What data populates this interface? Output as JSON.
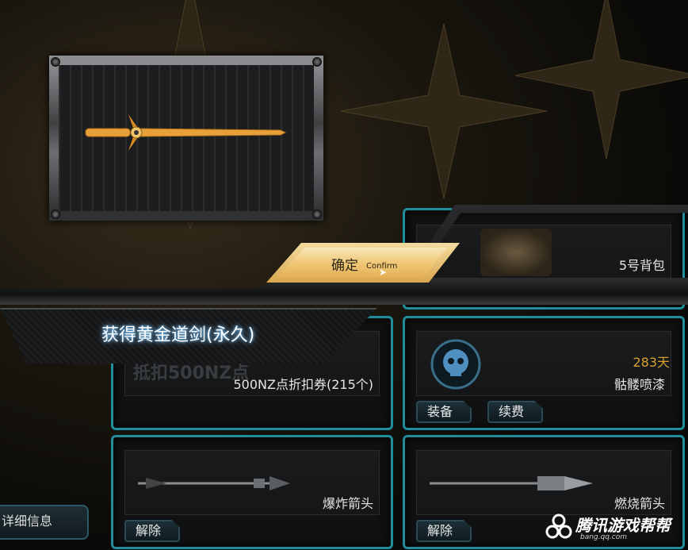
{
  "banner": {
    "title": "获得黄金道剑(永久)"
  },
  "confirm": {
    "label": "确定",
    "sub_label": "Confirm"
  },
  "cards": [
    {
      "id": "backpack",
      "name": "5号背包"
    },
    {
      "id": "coupon",
      "name": "500NZ点折扣券(215个)",
      "bg_text": "抵扣500NZ点"
    },
    {
      "id": "skull-spray",
      "name": "骷髅喷漆",
      "days": "283天",
      "buttons": [
        "装备",
        "续费"
      ]
    },
    {
      "id": "explosive-arrow",
      "name": "爆炸箭头",
      "buttons": [
        "解除"
      ]
    },
    {
      "id": "fire-arrow",
      "name": "燃烧箭头",
      "buttons": [
        "解除"
      ]
    }
  ],
  "side": {
    "detail_label": "详细信息"
  },
  "watermark": {
    "brand": "腾讯游戏帮帮",
    "url": "bang.qq.com"
  },
  "colors": {
    "card_border": "#1f8e9a",
    "days": "#d6a12f",
    "gold": "#e8a13a"
  }
}
